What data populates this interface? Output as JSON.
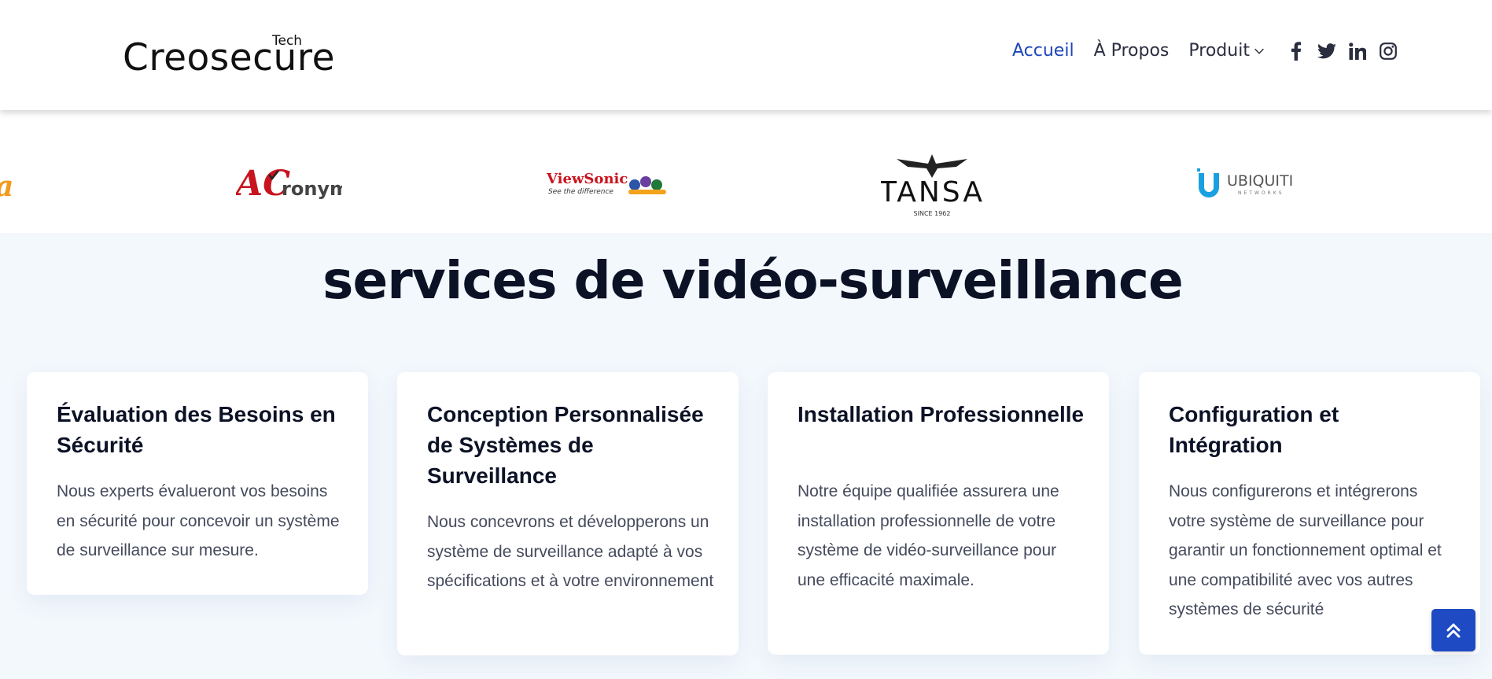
{
  "header": {
    "logo_main": "Creosecure",
    "logo_sup": "Tech",
    "nav": [
      {
        "label": "Accueil",
        "active": true
      },
      {
        "label": "À Propos",
        "active": false
      },
      {
        "label": "Produit",
        "active": false
      }
    ],
    "social_icons": [
      "facebook-icon",
      "twitter-icon",
      "linkedin-icon",
      "instagram-icon"
    ]
  },
  "partners": {
    "partial_logo_text": "a",
    "acronym_text": "ronym",
    "acronym_letters": "AC",
    "viewsonic_text": "ViewSonic",
    "viewsonic_tagline": "See the difference",
    "tansa_text": "TANSA",
    "tansa_since": "SINCE 1962",
    "ubiquiti_text": "UBIQUITI",
    "ubiquiti_sub": "NETWORKS"
  },
  "section": {
    "title": "services de vidéo-surveillance"
  },
  "cards": [
    {
      "title": "Évaluation des Besoins en Sécurité",
      "text": "Nous experts évalueront vos besoins en sécurité pour concevoir un système de surveillance sur mesure."
    },
    {
      "title": "Conception Personnalisée de Systèmes de Surveillance",
      "text": "Nous concevrons et développerons un système de surveillance adapté à vos spécifications et à votre environnement"
    },
    {
      "title": "Installation Professionnelle",
      "text": "Notre équipe qualifiée assurera une installation professionnelle de votre système de vidéo-surveillance pour une efficacité maximale."
    },
    {
      "title": "Configuration et Intégration",
      "text": "Nous configurerons et intégrerons votre système de surveillance pour garantir un fonctionnement optimal et une compatibilité avec vos autres systèmes de sécurité"
    }
  ],
  "colors": {
    "accent": "#1e46b9",
    "heading": "#0c1226",
    "body_text": "#454a5c",
    "section_bg": "#f3f8fd",
    "back_to_top": "#1e4ac4"
  }
}
